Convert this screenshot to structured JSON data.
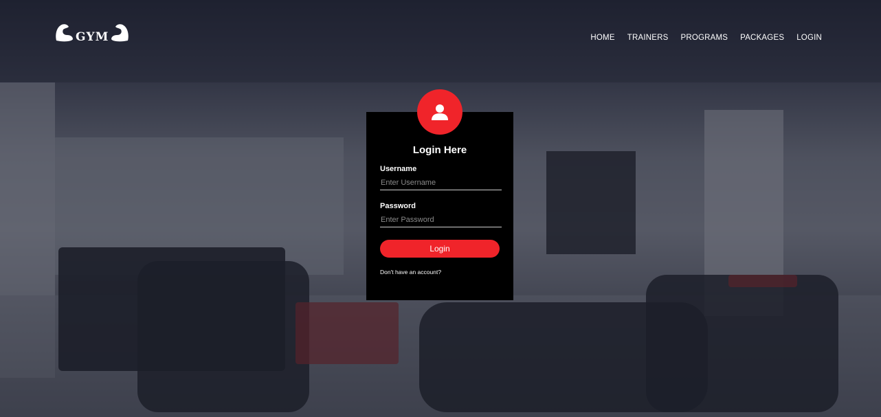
{
  "brand": {
    "logo_text": "GYM",
    "icon": "flexing-arm-icon"
  },
  "nav": {
    "items": [
      {
        "label": "HOME"
      },
      {
        "label": "TRAINERS"
      },
      {
        "label": "PROGRAMS"
      },
      {
        "label": "PACKAGES"
      },
      {
        "label": "LOGIN"
      }
    ]
  },
  "login": {
    "avatar_icon": "user-icon",
    "title": "Login Here",
    "username_label": "Username",
    "username_placeholder": "Enter Username",
    "username_value": "",
    "password_label": "Password",
    "password_placeholder": "Enter Password",
    "password_value": "",
    "submit_label": "Login",
    "signup_text": "Don't have an account?"
  },
  "colors": {
    "accent": "#f0242a",
    "card_bg": "#000000",
    "text": "#ffffff"
  }
}
